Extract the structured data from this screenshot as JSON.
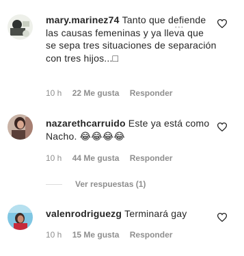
{
  "comments": [
    {
      "username": "mary.marinez74",
      "text": "Tanto que defiende las causas femeninas y ya lleva que se sepa tres situaciones de separación con tres hijos...□",
      "time": "10 h",
      "likes": "22 Me gusta",
      "reply": "Responder",
      "more": "⋯"
    },
    {
      "username": "nazarethcarruido",
      "text": "Este ya está como Nacho. 😂😂😂😂",
      "time": "10 h",
      "likes": "44 Me gusta",
      "reply": "Responder"
    },
    {
      "username": "valenrodriguezg",
      "text": "Terminará gay",
      "time": "10 h",
      "likes": "15 Me gusta",
      "reply": "Responder"
    }
  ],
  "view_replies": "Ver respuestas (1)",
  "icons": {
    "like": "heart-outline-icon",
    "more": "more-options-icon"
  },
  "colors": {
    "text": "#262626",
    "secondary": "#8e8e8e",
    "divider": "#dbdbdb"
  }
}
